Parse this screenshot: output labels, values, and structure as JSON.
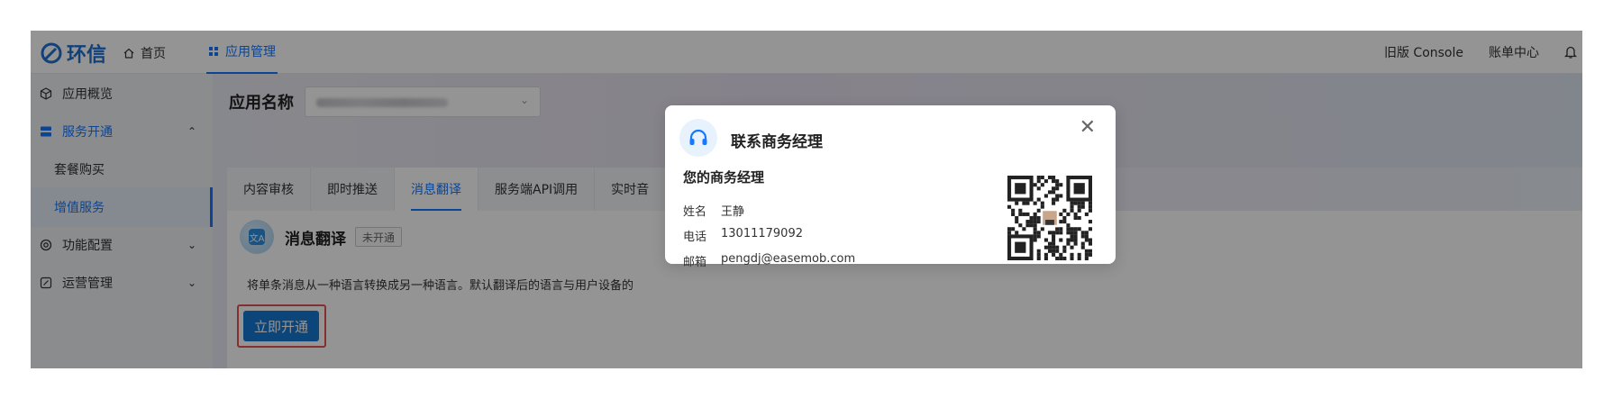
{
  "topbar": {
    "logo_text": "环信",
    "nav_home": "首页",
    "nav_app": "应用管理",
    "legacy_console": "旧版 Console",
    "billing": "账单中心"
  },
  "sidebar": {
    "items": [
      {
        "label": "应用概览",
        "icon": "cube-icon"
      },
      {
        "label": "服务开通",
        "icon": "service-icon"
      },
      {
        "label": "套餐购买"
      },
      {
        "label": "增值服务"
      },
      {
        "label": "功能配置",
        "icon": "target-icon"
      },
      {
        "label": "运营管理",
        "icon": "edit-box-icon"
      }
    ]
  },
  "main": {
    "app_name_label": "应用名称",
    "tabs": [
      "内容审核",
      "即时推送",
      "消息翻译",
      "服务端API调用",
      "实时音"
    ],
    "service_title": "消息翻译",
    "service_status": "未开通",
    "service_desc": "将单条消息从一种语言转换成另一种语言。默认翻译后的语言与用户设备的",
    "activate_label": "立即开通"
  },
  "modal": {
    "title": "联系商务经理",
    "manager_heading": "您的商务经理",
    "name_label": "姓名",
    "name_value": "王静",
    "phone_label": "电话",
    "phone_value": "13011179092",
    "email_label": "邮箱",
    "email_value": "pengdj@easemob.com"
  },
  "colors": {
    "accent": "#1677ff",
    "button": "#1677d2",
    "highlight_border": "#e55353"
  }
}
